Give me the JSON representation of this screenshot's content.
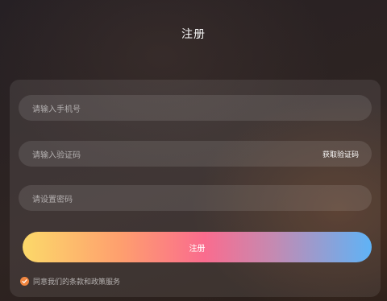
{
  "header": {
    "title": "注册"
  },
  "form": {
    "phone_placeholder": "请输入手机号",
    "code_placeholder": "请输入验证码",
    "get_code_label": "获取验证码",
    "password_placeholder": "请设置密码",
    "submit_label": "注册",
    "agreement_text": "同意我们的条款和政策服务",
    "agreement_checked": true
  },
  "colors": {
    "check_accent": "#f08640",
    "button_gradient": [
      "#fcd96a",
      "#fe9f6e",
      "#fa6c8e",
      "#c48ab2",
      "#5fb3f6"
    ]
  },
  "icons": {
    "agreement_check": "check-circle-icon"
  }
}
